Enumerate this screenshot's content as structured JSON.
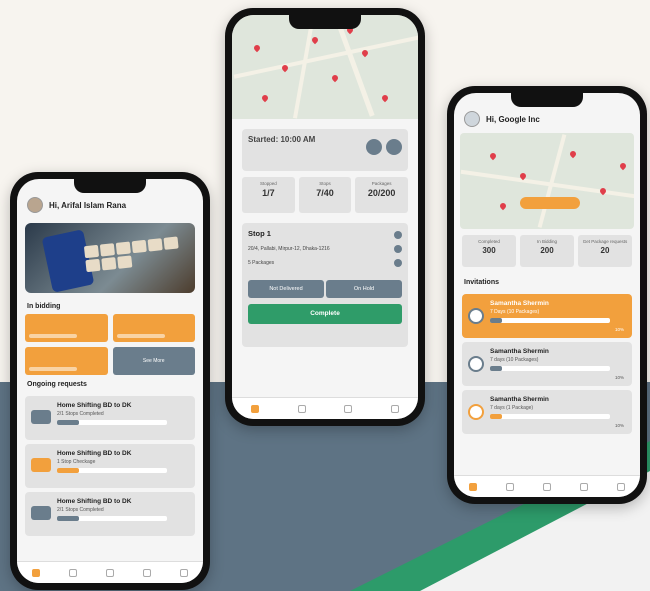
{
  "colors": {
    "accent": "#f2a03d",
    "slate": "#6a7d8c",
    "green": "#2f9c69"
  },
  "phone1": {
    "greeting": "Hi, Arifal Islam Rana",
    "section_bidding": "In bidding",
    "see_more": "See More",
    "section_ongoing": "Ongoing requests",
    "requests": [
      {
        "title": "Home Shifting BD to DK",
        "sub": "2/1 Stops Completed",
        "pct": "20%",
        "progress": 0.2
      },
      {
        "title": "Home Shifting BD to DK",
        "sub": "1 Stop Checkage",
        "pct": "20%",
        "progress": 0.2
      },
      {
        "title": "Home Shifting BD to DK",
        "sub": "2/1 Stops Completed",
        "pct": "20%",
        "progress": 0.2
      }
    ]
  },
  "phone2": {
    "started": "Started: 10:00 AM",
    "stats": [
      {
        "label": "Stopped",
        "value": "1/7"
      },
      {
        "label": "Stops",
        "value": "7/40"
      },
      {
        "label": "Packages",
        "value": "20/200"
      }
    ],
    "stop_title": "Stop 1",
    "stop_address": "20/4, Pallabi, Mirpur-12, Dhaka-1216",
    "stop_packages": "5 Packages",
    "btn_not_delivered": "Not Delivered",
    "btn_on_hold": "On Hold",
    "btn_complete": "Complete"
  },
  "phone3": {
    "greeting": "Hi, Google Inc",
    "summary": [
      {
        "label": "Completed",
        "value": "300"
      },
      {
        "label": "In Bidding",
        "value": "200"
      },
      {
        "label": "Get Package requests",
        "value": "20"
      }
    ],
    "section_invitations": "Invitations",
    "invitations": [
      {
        "name": "Samantha Shermin",
        "sub": "7 Days (10 Packages)",
        "pct": "10%",
        "progress": 0.1,
        "highlight": true
      },
      {
        "name": "Samantha Shermin",
        "sub": "7 days (10 Packages)",
        "pct": "10%",
        "progress": 0.1,
        "highlight": false
      },
      {
        "name": "Samantha Shermin",
        "sub": "7 days (1 Package)",
        "pct": "10%",
        "progress": 0.1,
        "highlight": false
      }
    ]
  }
}
